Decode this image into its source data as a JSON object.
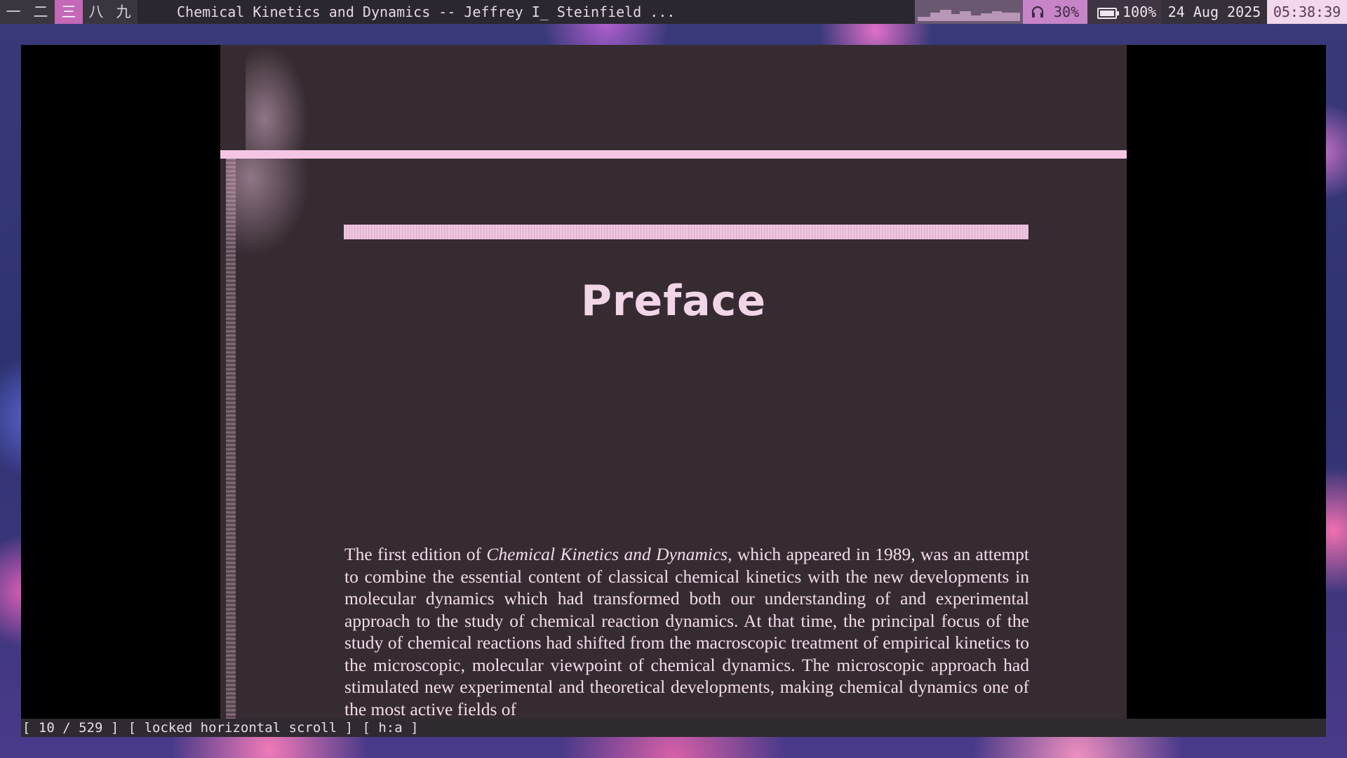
{
  "topbar": {
    "workspaces": [
      {
        "label": "一",
        "active": false
      },
      {
        "label": "二",
        "active": false
      },
      {
        "label": "三",
        "active": true
      },
      {
        "label": "八",
        "active": false
      },
      {
        "label": "九",
        "active": false
      }
    ],
    "window_title": "Chemical Kinetics and Dynamics -- Jeffrey I_ Steinfield ...",
    "volume": "30%",
    "battery": "100%",
    "date": "24 Aug 2025",
    "time": "05:38:39"
  },
  "document": {
    "heading": "Preface",
    "paragraph_before_italic": "The first edition of ",
    "paragraph_italic": "Chemical Kinetics and Dynamics,",
    "paragraph_after_italic": " which appeared in 1989, was an attempt to combine the essential content of classical chemical kinetics with the new developments in molecular dynamics which had transformed both our understanding of and experimental approach to the study of chemical reaction dynamics. At that time, the principal focus of the study of chemical reactions had shifted from the macroscopic treatment of empirical kinetics to the microscopic, molecular viewpoint of chemical dynamics. The microscopic approach had stimulated new experimental and theoretical developments, making chemical dynamics one of the most active fields of"
  },
  "status": {
    "page": "[ 10 / 529 ]",
    "scroll_mode": "[ locked horizontal scroll ]",
    "hint": "[ h:a ]"
  },
  "colors": {
    "accent": "#c468b8",
    "page_bg": "#352b31",
    "page_text": "#f4dcec",
    "rule": "#f4c6e4"
  }
}
